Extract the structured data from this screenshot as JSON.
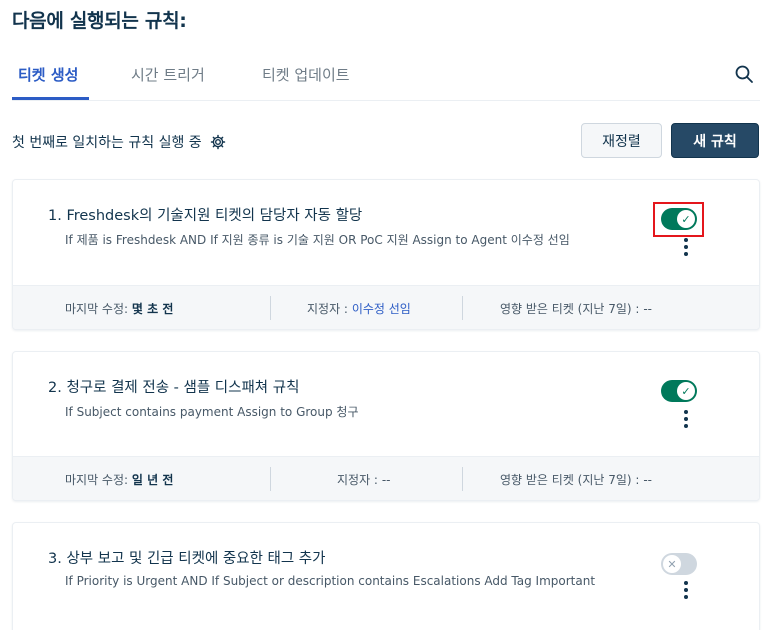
{
  "page": {
    "title": "다음에 실행되는 규칙:"
  },
  "tabs": [
    {
      "label": "티켓 생성",
      "active": true
    },
    {
      "label": "시간 트리거",
      "active": false
    },
    {
      "label": "티켓 업데이트",
      "active": false
    }
  ],
  "toolbar": {
    "mode_text": "첫 번째로 일치하는 규칙 실행 중",
    "reorder_label": "재정렬",
    "new_rule_label": "새 규칙"
  },
  "colors": {
    "accent": "#2c5cc5",
    "primary_button": "#264966",
    "toggle_on": "#00795b",
    "toggle_off": "#cfd7df",
    "highlight": "#e4161c"
  },
  "rules": [
    {
      "title": "1. Freshdesk의 기술지원 티켓의 담당자 자동 할당",
      "description": "If 제품 is Freshdesk AND If 지원 종류 is 기술 지원 OR PoC 지원 Assign to Agent 이수정 선임",
      "enabled": true,
      "highlighted": true,
      "modified_label": "마지막 수정:",
      "modified_value": "몇 초 전",
      "assignee_label": "지정자 :",
      "assignee_value": "이수정 선임",
      "affected_label": "영향 받은 티켓 (지난 7일) :",
      "affected_value": "--"
    },
    {
      "title": "2. 청구로 결제 전송 - 샘플 디스패쳐 규칙",
      "description": "If Subject contains payment Assign to Group 청구",
      "enabled": true,
      "highlighted": false,
      "modified_label": "마지막 수정:",
      "modified_value": "일 년 전",
      "assignee_label": "지정자 :",
      "assignee_value": "--",
      "affected_label": "영향 받은 티켓 (지난 7일) :",
      "affected_value": "--"
    },
    {
      "title": "3. 상부 보고 및 긴급 티켓에 중요한 태그 추가",
      "description": "If Priority is Urgent AND If Subject or description contains Escalations Add Tag Important",
      "enabled": false,
      "highlighted": false
    }
  ],
  "icons": {
    "search": "search-icon",
    "settings": "gear-icon",
    "more": "kebab-menu-icon",
    "toggle_on": "check-icon",
    "toggle_off": "x-icon"
  }
}
